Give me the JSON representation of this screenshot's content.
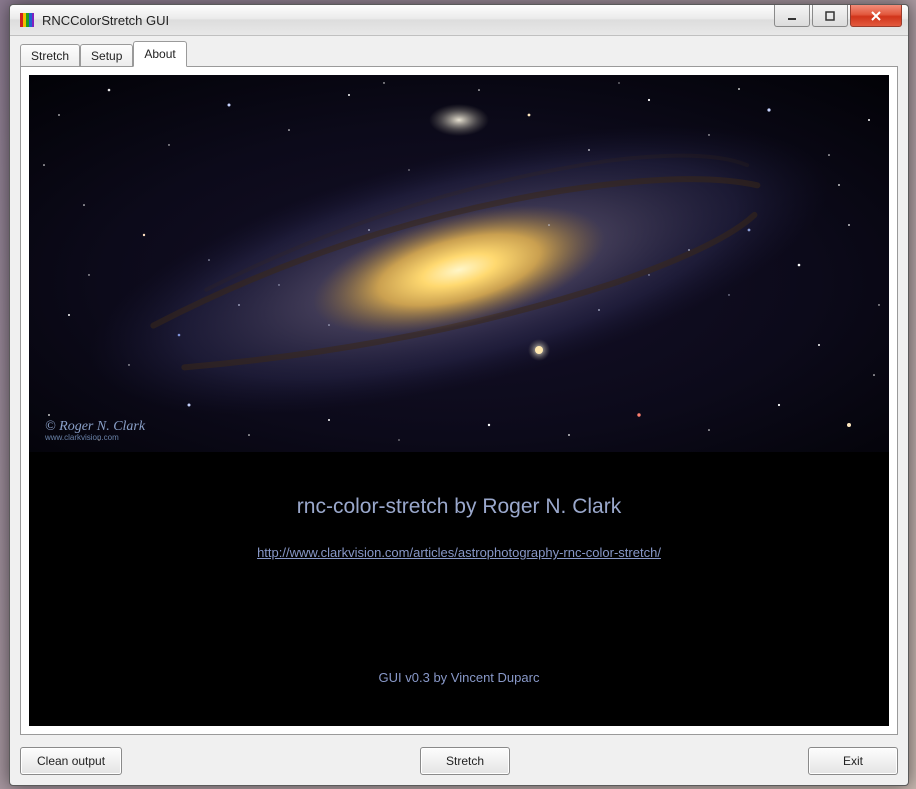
{
  "window": {
    "title": "RNCColorStretch GUI"
  },
  "tabs": [
    {
      "label": "Stretch",
      "active": false
    },
    {
      "label": "Setup",
      "active": false
    },
    {
      "label": "About",
      "active": true
    }
  ],
  "about": {
    "image_credit_line1": "© Roger N. Clark",
    "image_credit_line2": "www.clarkvision.com",
    "title": "rnc-color-stretch by Roger N. Clark",
    "link": "http://www.clarkvision.com/articles/astrophotography-rnc-color-stretch/",
    "footer": "GUI v0.3 by Vincent Duparc"
  },
  "buttons": {
    "clean_output": "Clean output",
    "stretch": "Stretch",
    "exit": "Exit"
  }
}
